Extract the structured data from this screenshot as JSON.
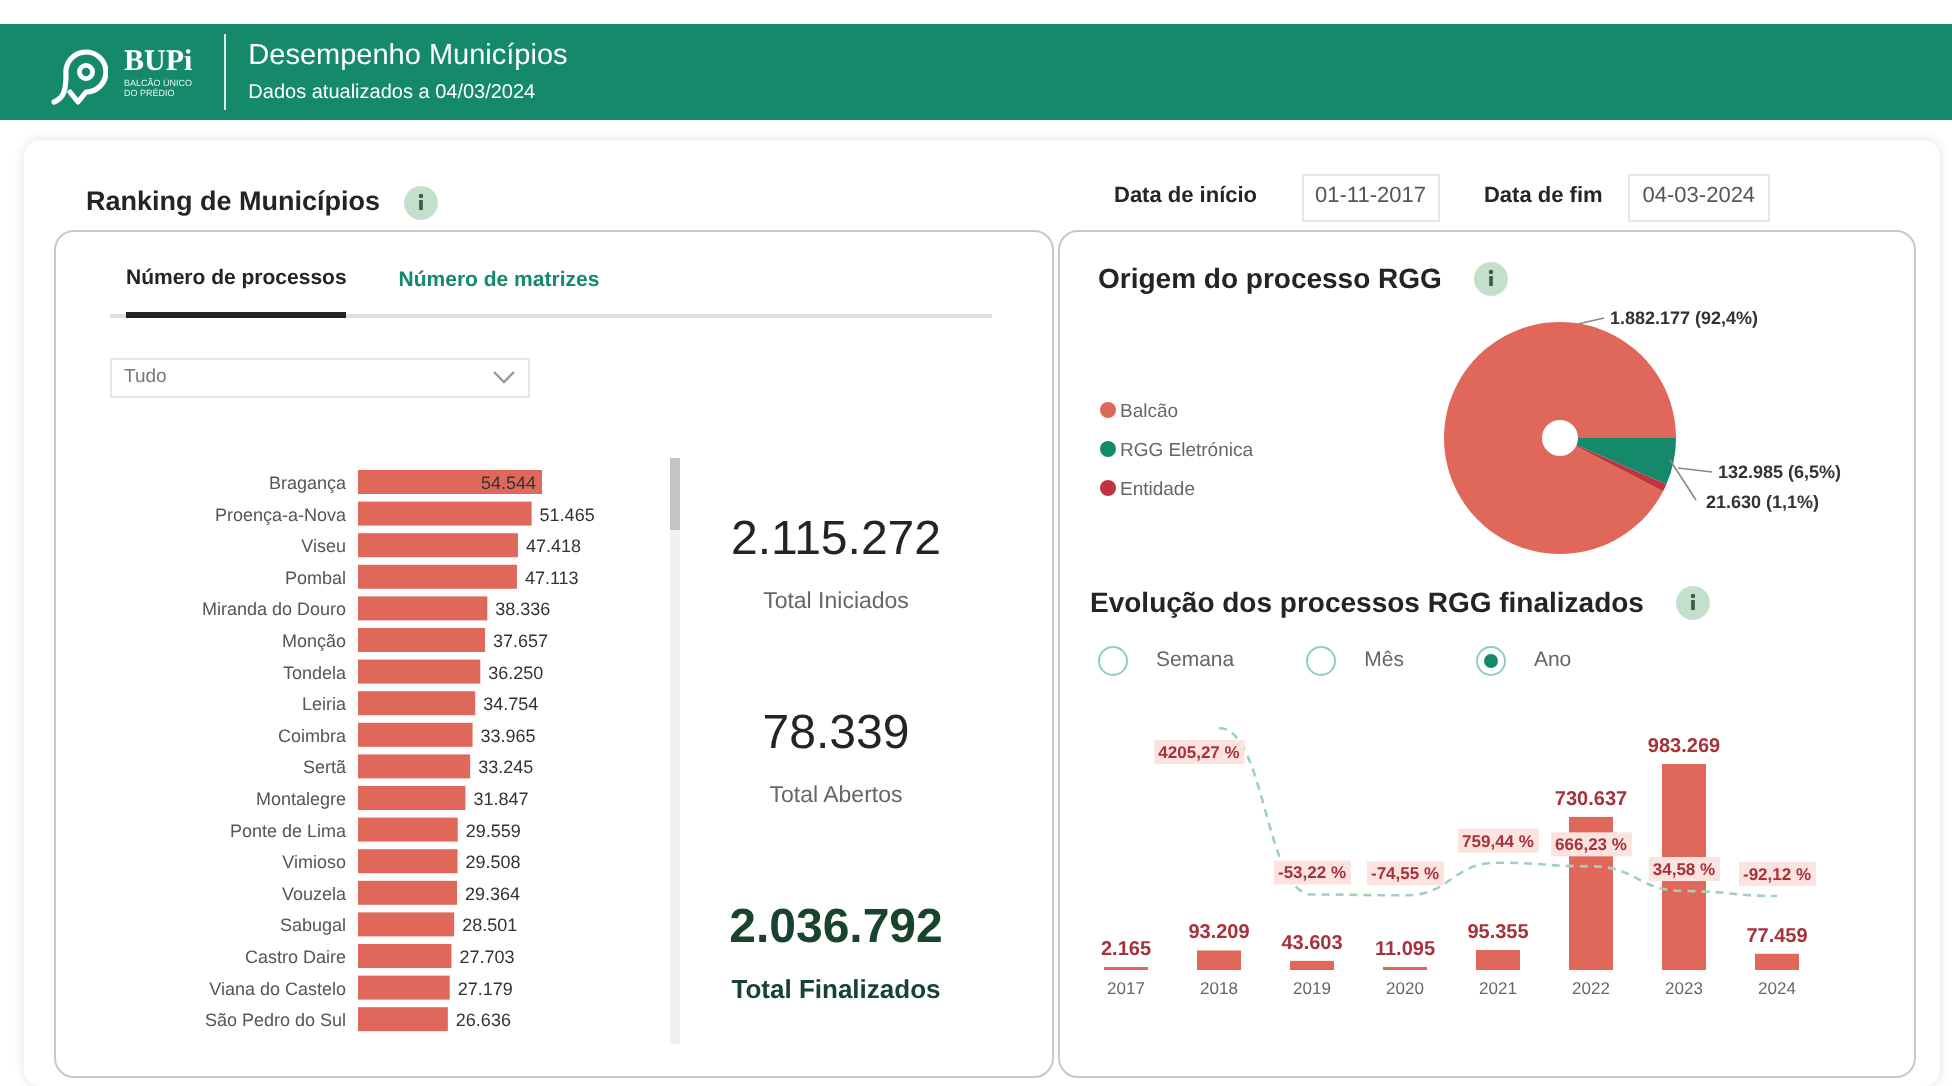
{
  "header": {
    "brand": "BUPi",
    "brand_subtitle": [
      "BALCÃO ÚNICO",
      "DO PRÉDIO"
    ],
    "title": "Desempenho Municípios",
    "subtitle": "Dados atualizados a 04/03/2024"
  },
  "ranking": {
    "title": "Ranking de Municípios",
    "tabs": [
      {
        "label": "Número de processos",
        "selected": true
      },
      {
        "label": "Número de matrizes",
        "selected": false
      }
    ],
    "filter": {
      "value": "Tudo"
    },
    "chart_data": {
      "type": "bar",
      "orientation": "horizontal",
      "categories": [
        "Bragança",
        "Proença-a-Nova",
        "Viseu",
        "Pombal",
        "Miranda do Douro",
        "Monção",
        "Tondela",
        "Leiria",
        "Coimbra",
        "Sertã",
        "Montalegre",
        "Ponte de Lima",
        "Vimioso",
        "Vouzela",
        "Sabugal",
        "Castro Daire",
        "Viana do Castelo",
        "São Pedro do Sul"
      ],
      "values": [
        54544,
        51465,
        47418,
        47113,
        38336,
        37657,
        36250,
        34754,
        33965,
        33245,
        31847,
        29559,
        29508,
        29364,
        28501,
        27703,
        27179,
        26636
      ],
      "value_labels": [
        "54.544",
        "51.465",
        "47.418",
        "47.113",
        "38.336",
        "37.657",
        "36.250",
        "34.754",
        "33.965",
        "33.245",
        "31.847",
        "29.559",
        "29.508",
        "29.364",
        "28.501",
        "27.703",
        "27.179",
        "26.636"
      ]
    },
    "kpis": [
      {
        "value": "2.115.272",
        "label": "Total Iniciados",
        "kind": "plain"
      },
      {
        "value": "78.339",
        "label": "Total Abertos",
        "kind": "plain"
      },
      {
        "value": "2.036.792",
        "label": "Total Finalizados",
        "kind": "highlight"
      }
    ]
  },
  "date_range": [
    {
      "label": "Data de início",
      "value": "01-11-2017"
    },
    {
      "label": "Data de fim",
      "value": "04-03-2024"
    }
  ],
  "origin": {
    "title": "Origem do processo RGG",
    "chart_data": {
      "type": "pie",
      "legend": "left",
      "categories": [
        "Balcão",
        "RGG Eletrónica",
        "Entidade"
      ],
      "values": [
        1882177,
        132985,
        21630
      ],
      "colors": [
        "#e0685a",
        "#148a6b",
        "#c0343f"
      ],
      "value_labels": [
        "1.882.177 (92,4%)",
        "132.985 (6,5%)",
        "21.630 (1,1%)"
      ]
    }
  },
  "evolution": {
    "title": "Evolução dos processos RGG finalizados",
    "periods": [
      {
        "label": "Semana",
        "selected": false
      },
      {
        "label": "Mês",
        "selected": false
      },
      {
        "label": "Ano",
        "selected": true
      }
    ],
    "chart_data": {
      "type": "bar",
      "categories": [
        "2017",
        "2018",
        "2019",
        "2020",
        "2021",
        "2022",
        "2023",
        "2024"
      ],
      "series": [
        {
          "type": "bar",
          "color": "#e0685a",
          "values": [
            2165,
            93209,
            43603,
            11095,
            95355,
            730637,
            983269,
            77459
          ],
          "value_labels": [
            "2.165",
            "93.209",
            "43.603",
            "11.095",
            "95.355",
            "730.637",
            "983.269",
            "77.459"
          ]
        },
        {
          "type": "line",
          "axis": "y2",
          "line_style": "dashed",
          "color": "#9fd3b5",
          "values": [
            null,
            4205.27,
            -53.22,
            -74.55,
            759.44,
            666.23,
            34.58,
            -92.12
          ],
          "value_labels": [
            null,
            "4205,27 %",
            "-53,22 %",
            "-74,55 %",
            "759,44 %",
            "666,23 %",
            "34,58 %",
            "-92,12 %"
          ]
        }
      ]
    }
  }
}
